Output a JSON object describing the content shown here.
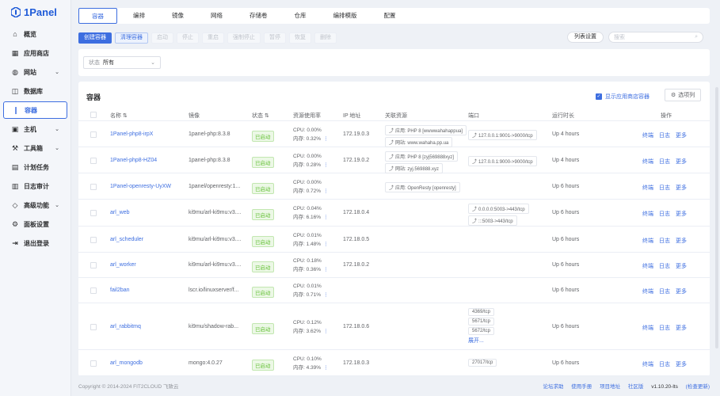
{
  "app": {
    "name": "1Panel",
    "brand_color": "#3d6ee0"
  },
  "sidebar": {
    "items": [
      {
        "label": "概览",
        "icon": "home-icon",
        "chev": false
      },
      {
        "label": "应用商店",
        "icon": "grid-icon",
        "chev": false
      },
      {
        "label": "网站",
        "icon": "globe-icon",
        "chev": true
      },
      {
        "label": "数据库",
        "icon": "database-icon",
        "chev": false
      },
      {
        "label": "容器",
        "icon": "container-icon",
        "chev": false,
        "active": true
      },
      {
        "label": "主机",
        "icon": "host-icon",
        "chev": true
      },
      {
        "label": "工具箱",
        "icon": "toolbox-icon",
        "chev": true
      },
      {
        "label": "计划任务",
        "icon": "calendar-icon",
        "chev": false
      },
      {
        "label": "日志审计",
        "icon": "log-icon",
        "chev": false
      },
      {
        "label": "高级功能",
        "icon": "diamond-icon",
        "chev": true
      },
      {
        "label": "面板设置",
        "icon": "settings-icon",
        "chev": false
      },
      {
        "label": "退出登录",
        "icon": "logout-icon",
        "chev": false
      }
    ]
  },
  "tabs": [
    "容器",
    "编排",
    "镜像",
    "网络",
    "存储卷",
    "仓库",
    "编排模版",
    "配置"
  ],
  "actions": {
    "create": "创建容器",
    "clean": "清理容器",
    "start": "启动",
    "stop": "停止",
    "restart": "重启",
    "force_stop": "强制停止",
    "pause": "暂停",
    "resume": "恢复",
    "delete": "删除",
    "list_settings": "列表设置",
    "search_placeholder": "搜索"
  },
  "filter": {
    "label": "状态",
    "value": "所有"
  },
  "panel": {
    "title": "容器",
    "show_store": "显示应用商店容器",
    "options": "选项列",
    "headers": {
      "name": "名称",
      "image": "镜像",
      "status": "状态",
      "resources": "资源使用率",
      "ip": "IP 地址",
      "related": "关联资源",
      "ports": "端口",
      "uptime": "运行时长",
      "ops": "操作"
    }
  },
  "rows": [
    {
      "name": "1Panel-php8-irpX",
      "image": "1panel-php:8.3.8",
      "status": "已启动",
      "cpu": "0.00%",
      "mem": "0.32%",
      "ip": "172.19.0.3",
      "related": [
        "应用: PHP 8 [wwwwahahappua]",
        "网站: www.wahaha.pp.ua"
      ],
      "ports": [
        "127.0.0.1:9001->9000/tcp"
      ],
      "uptime": "Up 4 hours"
    },
    {
      "name": "1Panel-php8-HZ04",
      "image": "1panel-php:8.3.8",
      "status": "已启动",
      "cpu": "0.00%",
      "mem": "0.28%",
      "ip": "172.19.0.2",
      "related": [
        "应用: PHP 8 [zyj569888xyz]",
        "网站: zyj.569888.xyz"
      ],
      "ports": [
        "127.0.0.1:9000->9000/tcp"
      ],
      "uptime": "Up 4 hours"
    },
    {
      "name": "1Panel-openresty-UyXW",
      "image": "1panel/openresty:1...",
      "status": "已启动",
      "cpu": "0.00%",
      "mem": "0.72%",
      "ip": "",
      "related": [
        "应用: OpenResty [openresty]"
      ],
      "ports": [],
      "uptime": "Up 6 hours"
    },
    {
      "name": "arl_web",
      "image": "ki9mu/arl-ki9mu:v3....",
      "status": "已启动",
      "cpu": "0.04%",
      "mem": "6.16%",
      "ip": "172.18.0.4",
      "related": [],
      "ports": [
        "0.0.0.0:5003->443/tcp",
        ":::5003->443/tcp"
      ],
      "uptime": "Up 6 hours"
    },
    {
      "name": "arl_scheduler",
      "image": "ki9mu/arl-ki9mu:v3....",
      "status": "已启动",
      "cpu": "0.01%",
      "mem": "1.48%",
      "ip": "172.18.0.5",
      "related": [],
      "ports": [],
      "uptime": "Up 6 hours"
    },
    {
      "name": "arl_worker",
      "image": "ki9mu/arl-ki9mu:v3....",
      "status": "已启动",
      "cpu": "0.18%",
      "mem": "0.36%",
      "ip": "172.18.0.2",
      "related": [],
      "ports": [],
      "uptime": "Up 6 hours"
    },
    {
      "name": "fail2ban",
      "image": "lscr.io/linuxserver/f...",
      "status": "已启动",
      "cpu": "0.01%",
      "mem": "0.71%",
      "ip": "",
      "related": [],
      "ports": [],
      "uptime": "Up 6 hours"
    },
    {
      "name": "arl_rabbitmq",
      "image": "ki9mu/shadow-rab...",
      "status": "已启动",
      "cpu": "0.12%",
      "mem": "3.62%",
      "ip": "172.18.0.6",
      "related": [],
      "ports": [
        "4369/tcp",
        "5671/tcp",
        "5672/tcp"
      ],
      "more_ports": "展开...",
      "uptime": "Up 6 hours"
    },
    {
      "name": "arl_mongodb",
      "image": "mongo:4.0.27",
      "status": "已启动",
      "cpu": "0.10%",
      "mem": "4.39%",
      "ip": "172.18.0.3",
      "related": [],
      "ports": [
        "27017/tcp"
      ],
      "uptime": "Up 6 hours"
    }
  ],
  "row_labels": {
    "cpu": "CPU:",
    "mem": "内存:",
    "terminal": "终端",
    "log": "日志",
    "more": "更多"
  },
  "footer": {
    "copyright": "Copyright © 2014-2024 FIT2CLOUD 飞致云",
    "forum": "论坛求助",
    "manual": "使用手册",
    "project": "项目地址",
    "community": "社区版",
    "version": "v1.10.20-lts",
    "upgrade": "(检查更新)"
  }
}
